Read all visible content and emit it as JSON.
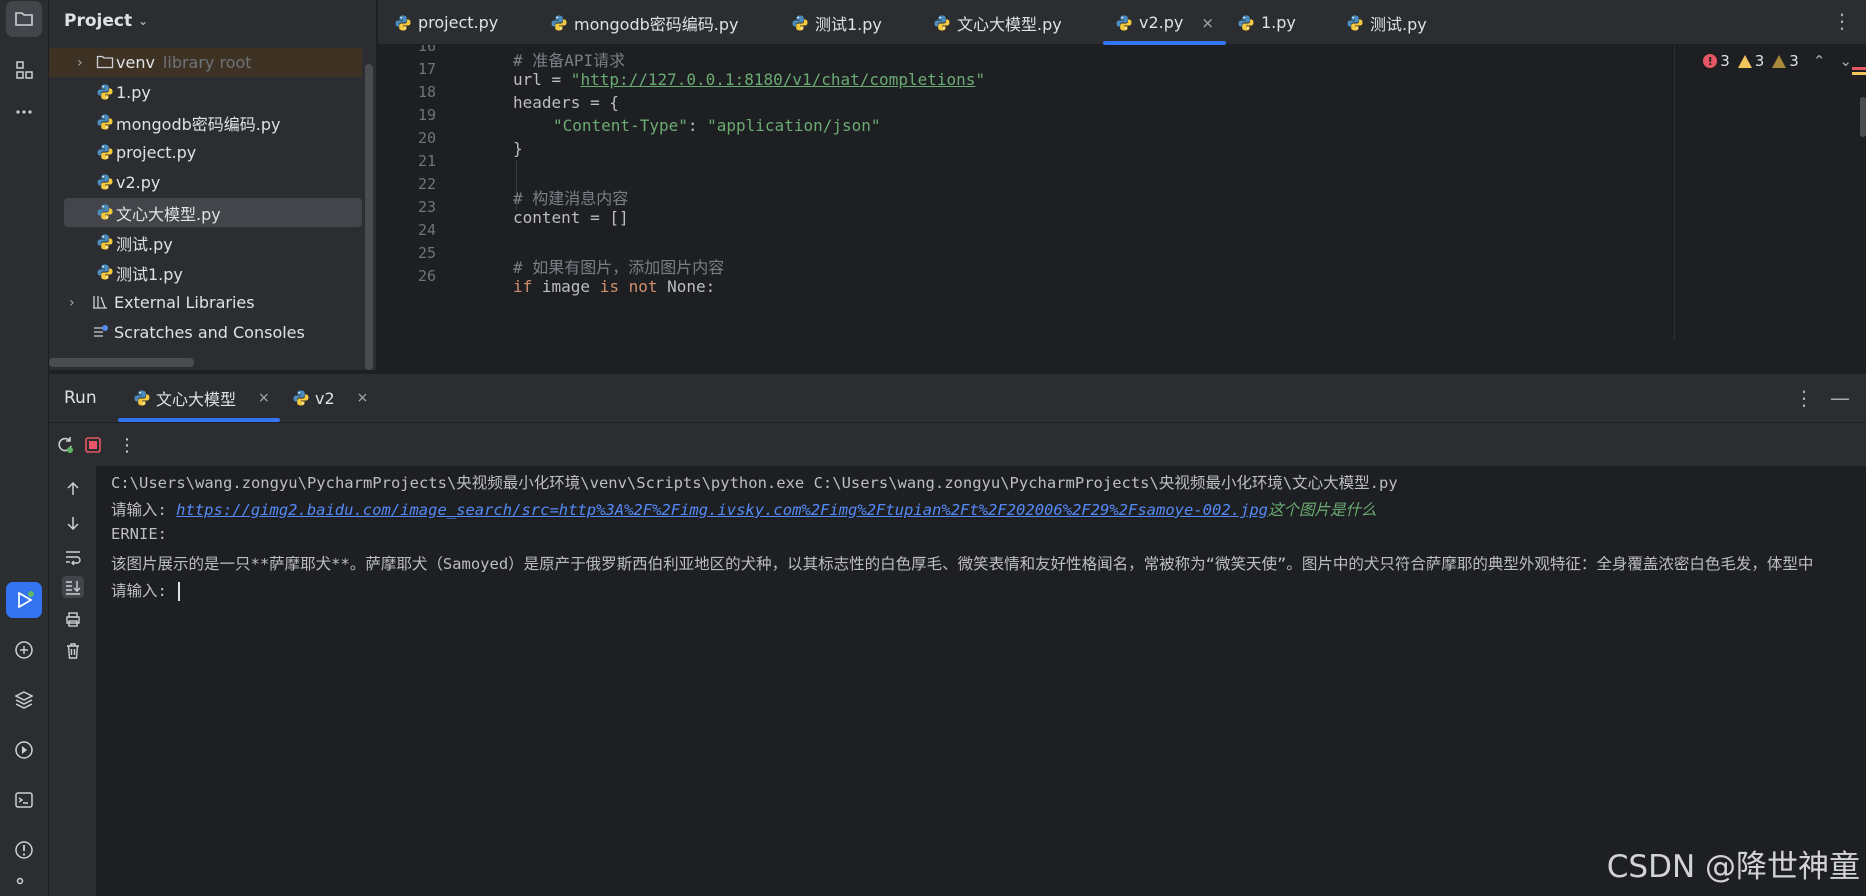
{
  "project_panel": {
    "title": "Project",
    "items": [
      {
        "label": "venv",
        "note": "library root",
        "type": "folder"
      },
      {
        "label": "1.py",
        "type": "python"
      },
      {
        "label": "mongodb密码编码.py",
        "type": "python"
      },
      {
        "label": "project.py",
        "type": "python"
      },
      {
        "label": "v2.py",
        "type": "python"
      },
      {
        "label": "文心大模型.py",
        "type": "python",
        "selected": true
      },
      {
        "label": "测试.py",
        "type": "python"
      },
      {
        "label": "测试1.py",
        "type": "python"
      },
      {
        "label": "External Libraries",
        "type": "library"
      },
      {
        "label": "Scratches and Consoles",
        "type": "scratch"
      }
    ]
  },
  "editor_tabs": [
    {
      "label": "project.py"
    },
    {
      "label": "mongodb密码编码.py"
    },
    {
      "label": "测试1.py"
    },
    {
      "label": "文心大模型.py"
    },
    {
      "label": "v2.py",
      "active": true,
      "close": "×"
    },
    {
      "label": "1.py"
    },
    {
      "label": "测试.py"
    }
  ],
  "inspections": {
    "errors": "3",
    "warnings": "3",
    "weak_warnings": "3"
  },
  "code": {
    "line_numbers": [
      "16",
      "17",
      "18",
      "19",
      "20",
      "21",
      "22",
      "23",
      "24",
      "25",
      "26"
    ],
    "l16": "# 准备API请求",
    "l17_var": "url = ",
    "l17_q1": "\"",
    "l17_url": "http://127.0.0.1:8180/v1/chat/completions",
    "l17_q2": "\"",
    "l18": "headers = {",
    "l19_key": "\"Content-Type\"",
    "l19_sep": ": ",
    "l19_val": "\"application/json\"",
    "l20": "}",
    "l22": "# 构建消息内容",
    "l23": "content = []",
    "l25": "# 如果有图片，添加图片内容",
    "l26_kw1": "if",
    "l26_mid": " image ",
    "l26_kw2": "is not",
    "l26_end": " None:"
  },
  "run_window": {
    "title": "Run",
    "tabs": [
      {
        "label": "文心大模型",
        "active": true,
        "close": "×"
      },
      {
        "label": "v2",
        "close": "×"
      }
    ]
  },
  "console": {
    "cmd": "C:\\Users\\wang.zongyu\\PycharmProjects\\央视频最小化环境\\venv\\Scripts\\python.exe C:\\Users\\wang.zongyu\\PycharmProjects\\央视频最小化环境\\文心大模型.py",
    "prompt1": "请输入: ",
    "link": "https://gimg2.baidu.com/image_search/src=http%3A%2F%2Fimg.ivsky.com%2Fimg%2Ftupian%2Ft%2F202006%2F29%2Fsamoye-002.jpg",
    "input1": "这个图片是什么",
    "speaker": "ERNIE:",
    "answer": "该图片展示的是一只**萨摩耶犬**。萨摩耶犬（Samoyed）是原产于俄罗斯西伯利亚地区的犬种，以其标志性的白色厚毛、微笑表情和友好性格闻名，常被称为“微笑天使”。图片中的犬只符合萨摩耶的典型外观特征：全身覆盖浓密白色毛发，体型中",
    "prompt2": "请输入: "
  },
  "watermark": "CSDN @降世神童",
  "colors": {
    "accent": "#3574f0",
    "error": "#e55765",
    "warning": "#f2c55c",
    "string": "#6aab73",
    "keyword": "#cf8e6d",
    "link": "#548af7",
    "comment": "#7a7e85"
  }
}
